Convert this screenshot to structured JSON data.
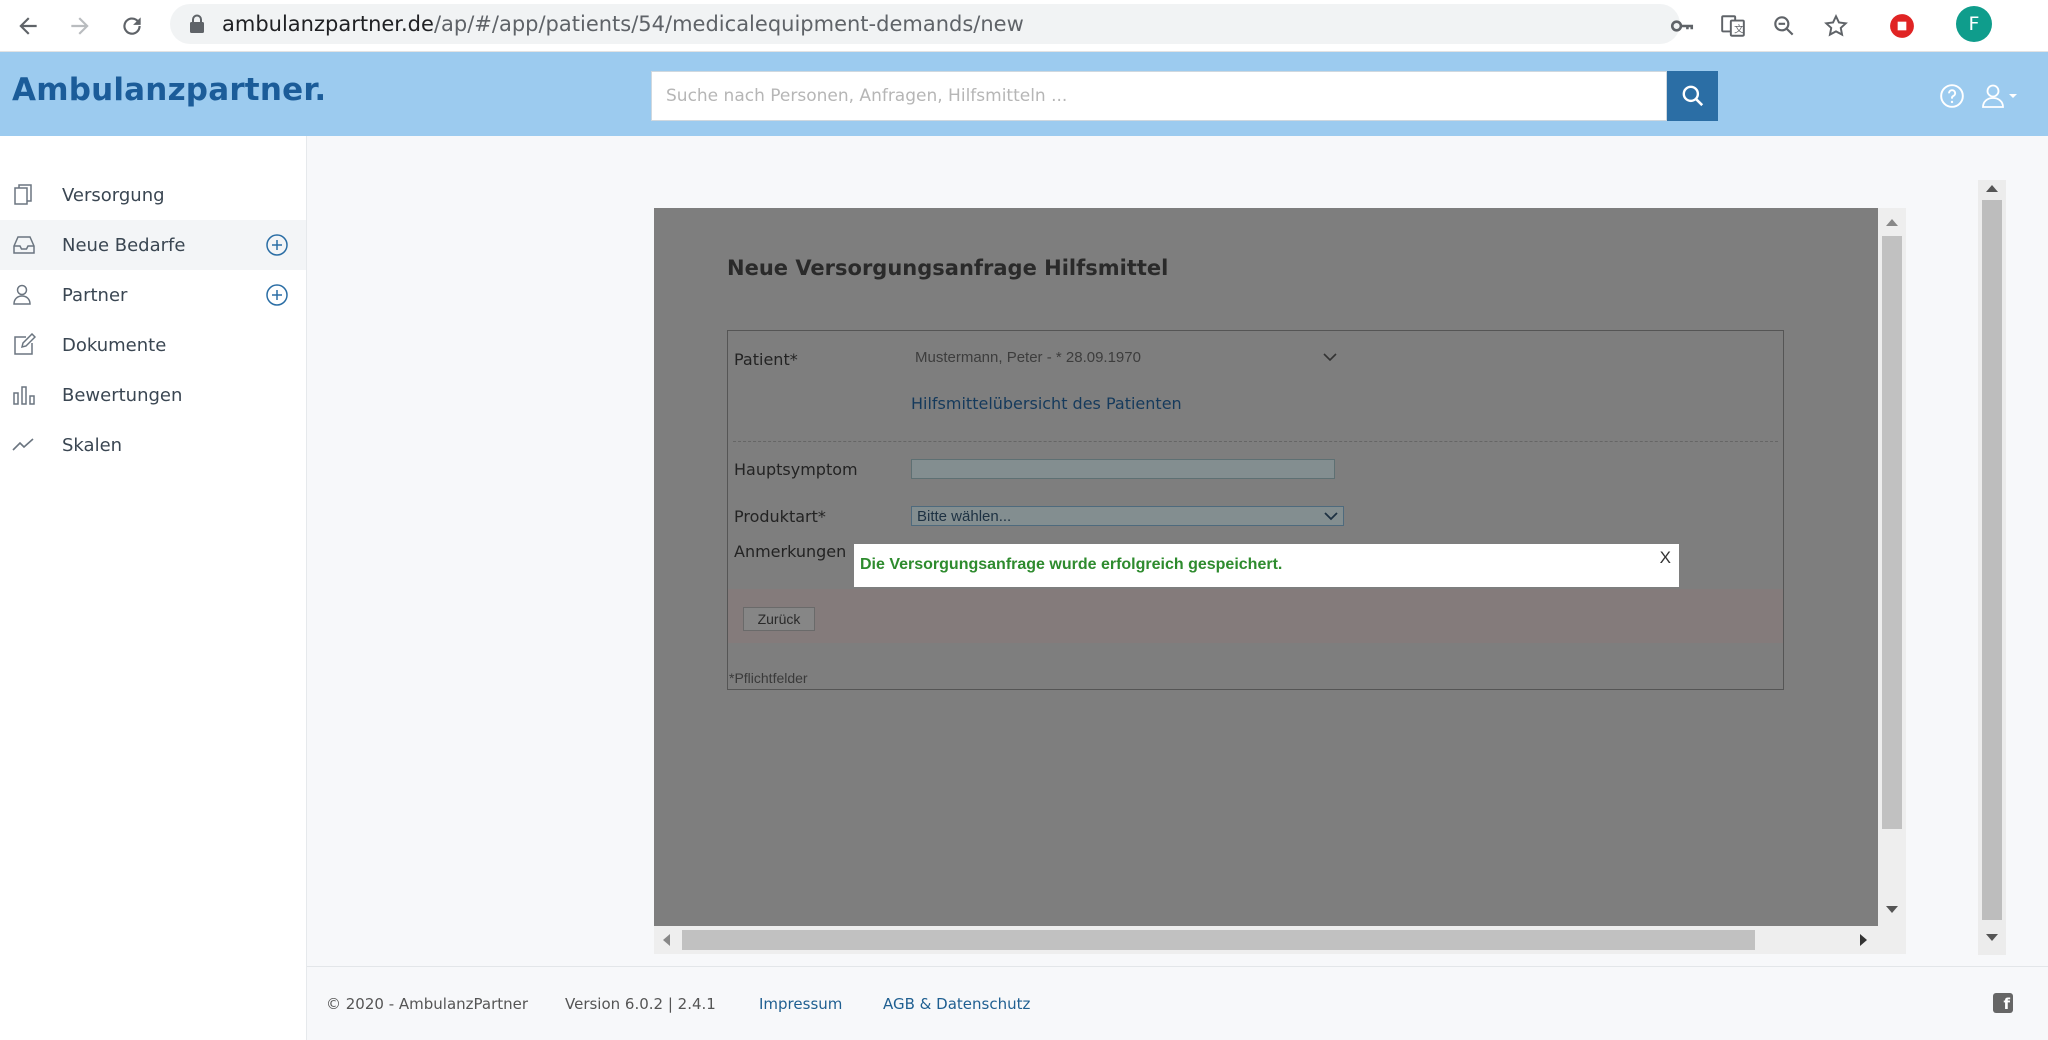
{
  "browser": {
    "url_host": "ambulanzpartner.de",
    "url_path": "/ap/#/app/patients/54/medicalequipment-demands/new",
    "profile_initial": "F"
  },
  "header": {
    "logo": "Ambulanzpartner.",
    "search_placeholder": "Suche nach Personen, Anfragen, Hilfsmitteln ..."
  },
  "sidebar": {
    "items": [
      {
        "label": "Versorgung",
        "icon": "documents-icon"
      },
      {
        "label": "Neue Bedarfe",
        "icon": "inbox-icon",
        "active": true
      },
      {
        "label": "Partner",
        "icon": "partner-icon"
      },
      {
        "label": "Dokumente",
        "icon": "edit-icon"
      },
      {
        "label": "Bewertungen",
        "icon": "bar-chart-icon"
      },
      {
        "label": "Skalen",
        "icon": "trend-icon"
      }
    ]
  },
  "form": {
    "title": "Neue Versorgungsanfrage Hilfsmittel",
    "patient_label": "Patient*",
    "patient_value": "Mustermann, Peter - * 28.09.1970",
    "overview_link": "Hilfsmittelübersicht des Patienten",
    "symptom_label": "Hauptsymptom",
    "product_label": "Produktart*",
    "product_value": "Bitte wählen...",
    "remarks_label": "Anmerkungen",
    "back_button": "Zurück",
    "required_note": "*Pflichtfelder"
  },
  "toast": {
    "message": "Die Versorgungsanfrage wurde erfolgreich gespeichert.",
    "close": "X"
  },
  "footer": {
    "copyright": "© 2020 - AmbulanzPartner",
    "version": "Version 6.0.2 | 2.4.1",
    "impressum": "Impressum",
    "agb": "AGB & Datenschutz"
  }
}
